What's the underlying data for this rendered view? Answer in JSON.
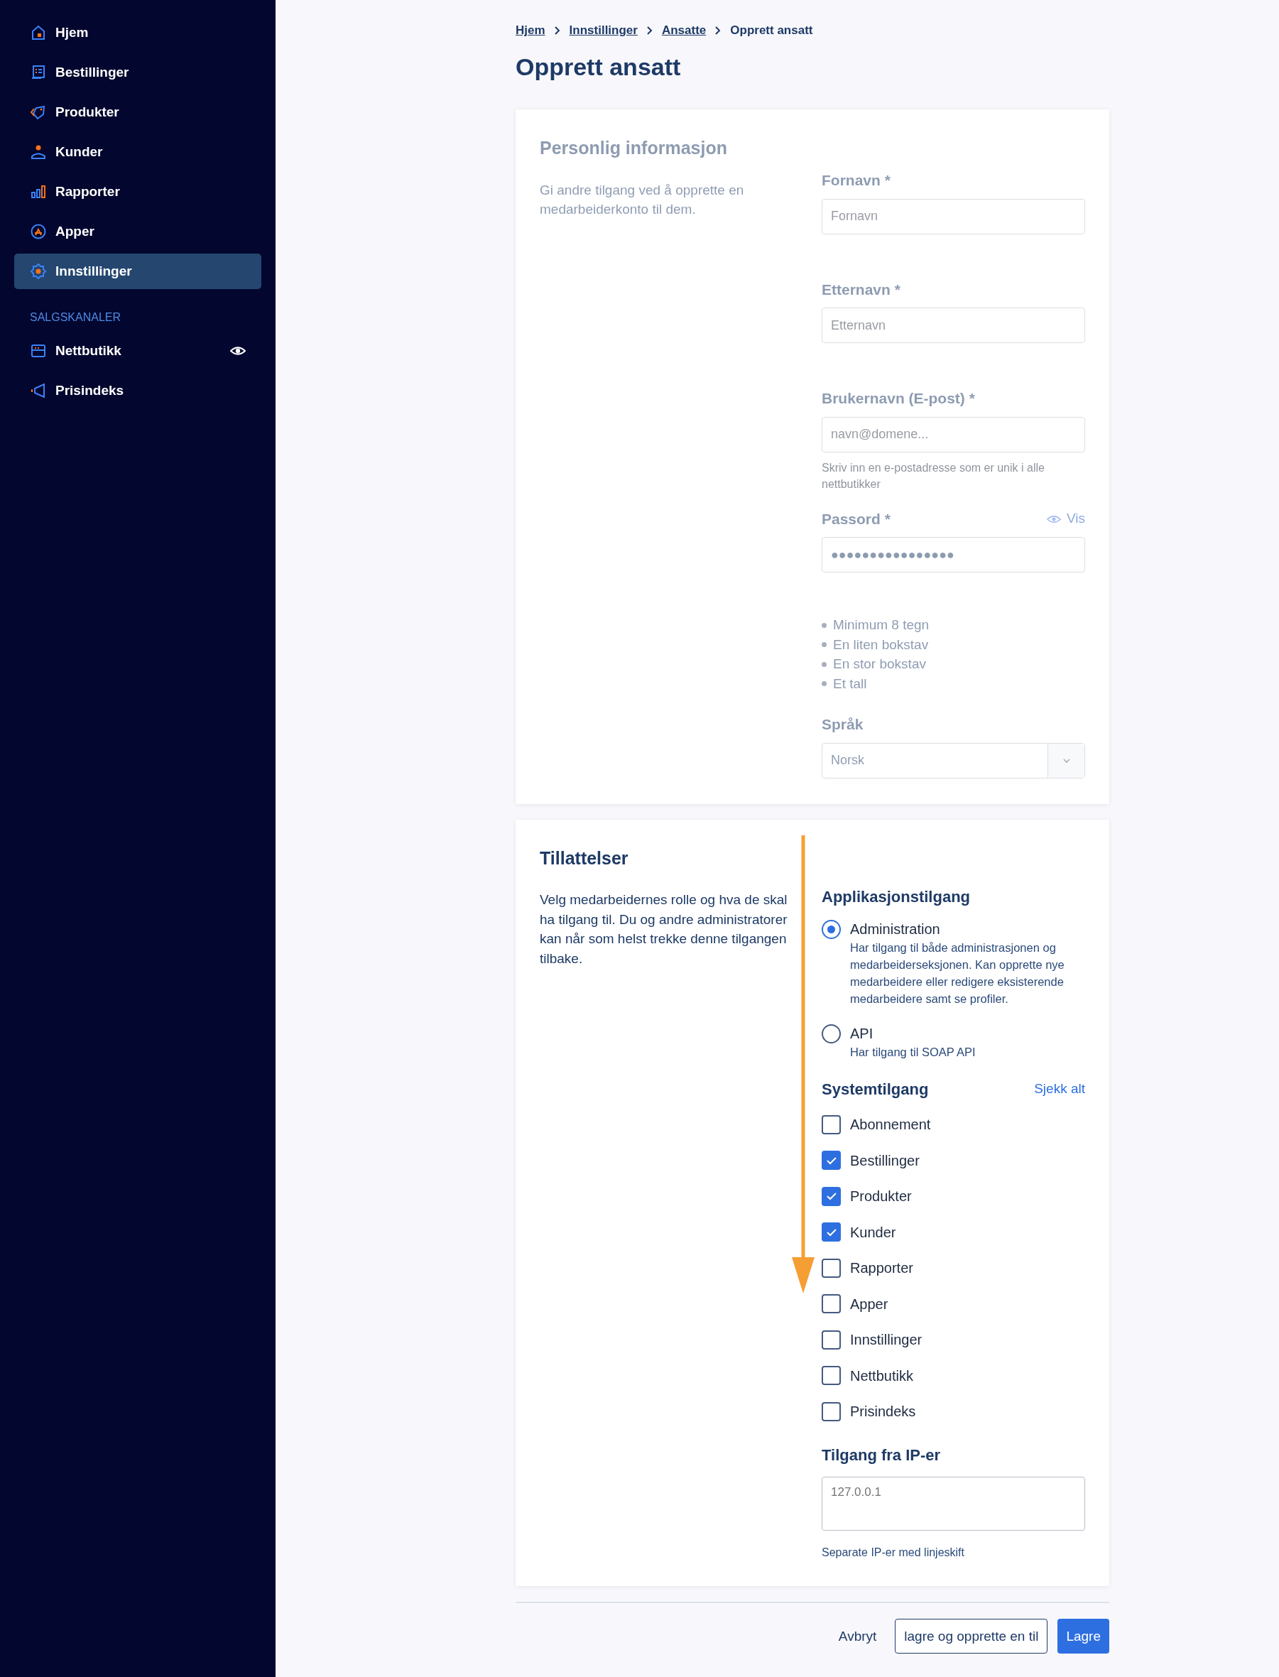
{
  "sidebar": {
    "items": [
      {
        "label": "Hjem",
        "selected": false
      },
      {
        "label": "Bestillinger",
        "selected": false
      },
      {
        "label": "Produkter",
        "selected": false
      },
      {
        "label": "Kunder",
        "selected": false
      },
      {
        "label": "Rapporter",
        "selected": false
      },
      {
        "label": "Apper",
        "selected": false
      },
      {
        "label": "Innstillinger",
        "selected": true
      }
    ],
    "section_title": "SALGSKANALER",
    "channels": [
      {
        "label": "Nettbutikk",
        "preview": true
      },
      {
        "label": "Prisindeks",
        "preview": false
      }
    ]
  },
  "breadcrumb": [
    {
      "label": "Hjem",
      "link": true
    },
    {
      "label": "Innstillinger",
      "link": true
    },
    {
      "label": "Ansatte",
      "link": true
    },
    {
      "label": "Opprett ansatt",
      "link": false
    }
  ],
  "title": "Opprett ansatt",
  "personal": {
    "faded": true,
    "title": "Personlig informasjon",
    "description": "Gi andre tilgang ved å opprette en medarbeiderkonto til dem.",
    "fields": [
      {
        "kind": "text",
        "label": "Fornavn *",
        "placeholder": "Fornavn"
      },
      {
        "kind": "text",
        "label": "Etternavn *",
        "placeholder": "Etternavn"
      },
      {
        "kind": "text",
        "label": "Brukernavn (E-post) *",
        "placeholder": "navn@domene...",
        "help": "Skriv inn en e-postadresse som er unik i alle nettbutikker"
      },
      {
        "kind": "password",
        "label": "Passord *",
        "toggle": "Vis",
        "value": "●●●●●●●●●●●●●●●●",
        "rules": [
          "Minimum 8 tegn",
          "En liten bokstav",
          "En stor bokstav",
          "Et tall"
        ]
      },
      {
        "kind": "select",
        "label": "Språk",
        "value": "Norsk"
      }
    ]
  },
  "permissions": {
    "faded": false,
    "title": "Tillattelser",
    "description": "Velg medarbeidernes rolle og hva de skal ha tilgang til. Du og andre administratorer kan når som helst trekke denne tilgangen tilbake.",
    "app_access": {
      "title": "Applikasjonstilgang",
      "options": [
        {
          "label": "Administration",
          "description": "Har tilgang til både administrasjonen og medarbeiderseksjonen. Kan opprette nye medarbeidere eller redigere eksisterende medarbeidere samt se profiler.",
          "selected": true
        },
        {
          "label": "API",
          "description": "Har tilgang til SOAP API",
          "selected": false
        }
      ]
    },
    "system_access": {
      "title": "Systemtilgang",
      "check_all": "Sjekk alt",
      "items": [
        {
          "label": "Abonnement",
          "checked": false
        },
        {
          "label": "Bestillinger",
          "checked": true
        },
        {
          "label": "Produkter",
          "checked": true
        },
        {
          "label": "Kunder",
          "checked": true
        },
        {
          "label": "Rapporter",
          "checked": false
        },
        {
          "label": "Apper",
          "checked": false
        },
        {
          "label": "Innstillinger",
          "checked": false
        },
        {
          "label": "Nettbutikk",
          "checked": false
        },
        {
          "label": "Prisindeks",
          "checked": false
        }
      ]
    },
    "ip_access": {
      "title": "Tilgang fra IP-er",
      "placeholder": "127.0.0.1",
      "help": "Separate IP-er med linjeskift"
    }
  },
  "footer": {
    "cancel": "Avbryt",
    "save_and_new": "lagre og opprette en til",
    "save": "Lagre"
  }
}
